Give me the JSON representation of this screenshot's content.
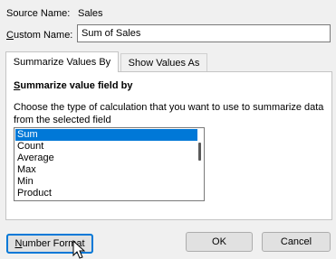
{
  "source": {
    "label": "Source Name:",
    "value": "Sales"
  },
  "custom_name": {
    "label_u": "C",
    "label_rest": "ustom Name:",
    "value": "Sum of Sales"
  },
  "tabs": [
    {
      "label": "Summarize Values By",
      "selected": true
    },
    {
      "label": "Show Values As",
      "selected": false
    }
  ],
  "panel": {
    "title_u": "S",
    "title_rest": "ummarize value field by",
    "description": "Choose the type of calculation that you want to use to summarize data from the selected field"
  },
  "functions": {
    "items": [
      "Sum",
      "Count",
      "Average",
      "Max",
      "Min",
      "Product"
    ],
    "selected": "Sum"
  },
  "buttons": {
    "number_format_u": "N",
    "number_format_rest": "umber Format",
    "ok": "OK",
    "cancel": "Cancel"
  },
  "colors": {
    "selection": "#0078d7",
    "dialog_bg": "#f0f0f0"
  }
}
